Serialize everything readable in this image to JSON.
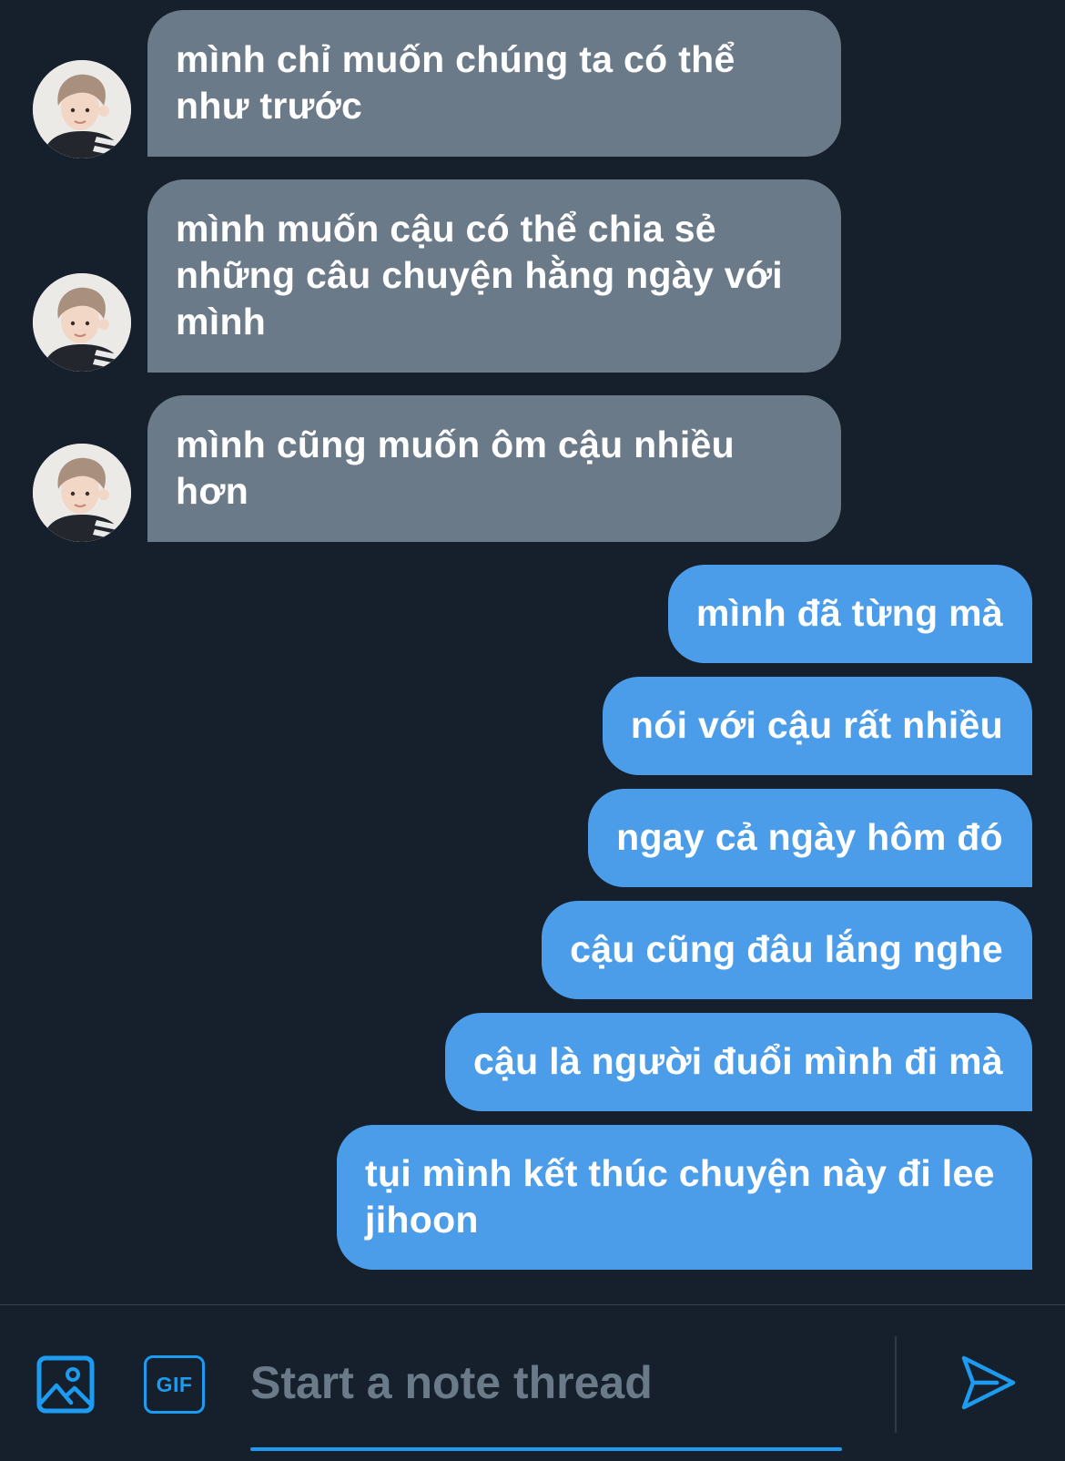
{
  "messages": [
    {
      "side": "received",
      "text": "mình chỉ muốn chúng ta có thể như trước"
    },
    {
      "side": "received",
      "text": "mình muốn cậu có thể chia sẻ những câu chuyện hằng ngày với mình"
    },
    {
      "side": "received",
      "text": "mình cũng muốn ôm cậu nhiều hơn"
    },
    {
      "side": "sent",
      "text": "mình đã từng mà"
    },
    {
      "side": "sent",
      "text": "nói với cậu rất nhiều"
    },
    {
      "side": "sent",
      "text": "ngay cả ngày hôm đó"
    },
    {
      "side": "sent",
      "text": "cậu cũng đâu lắng nghe"
    },
    {
      "side": "sent",
      "text": "cậu là người đuổi mình đi mà"
    },
    {
      "side": "sent",
      "text": "tụi mình kết thúc chuyện này đi lee jihoon"
    }
  ],
  "composer": {
    "placeholder": "Start a note thread",
    "gif_label": "GIF",
    "icons": [
      "image-icon",
      "gif-icon",
      "send-icon"
    ]
  },
  "colors": {
    "background": "#16202c",
    "received_bubble": "#6b7a89",
    "sent_bubble": "#4c9de9",
    "accent": "#1d9bf0"
  }
}
